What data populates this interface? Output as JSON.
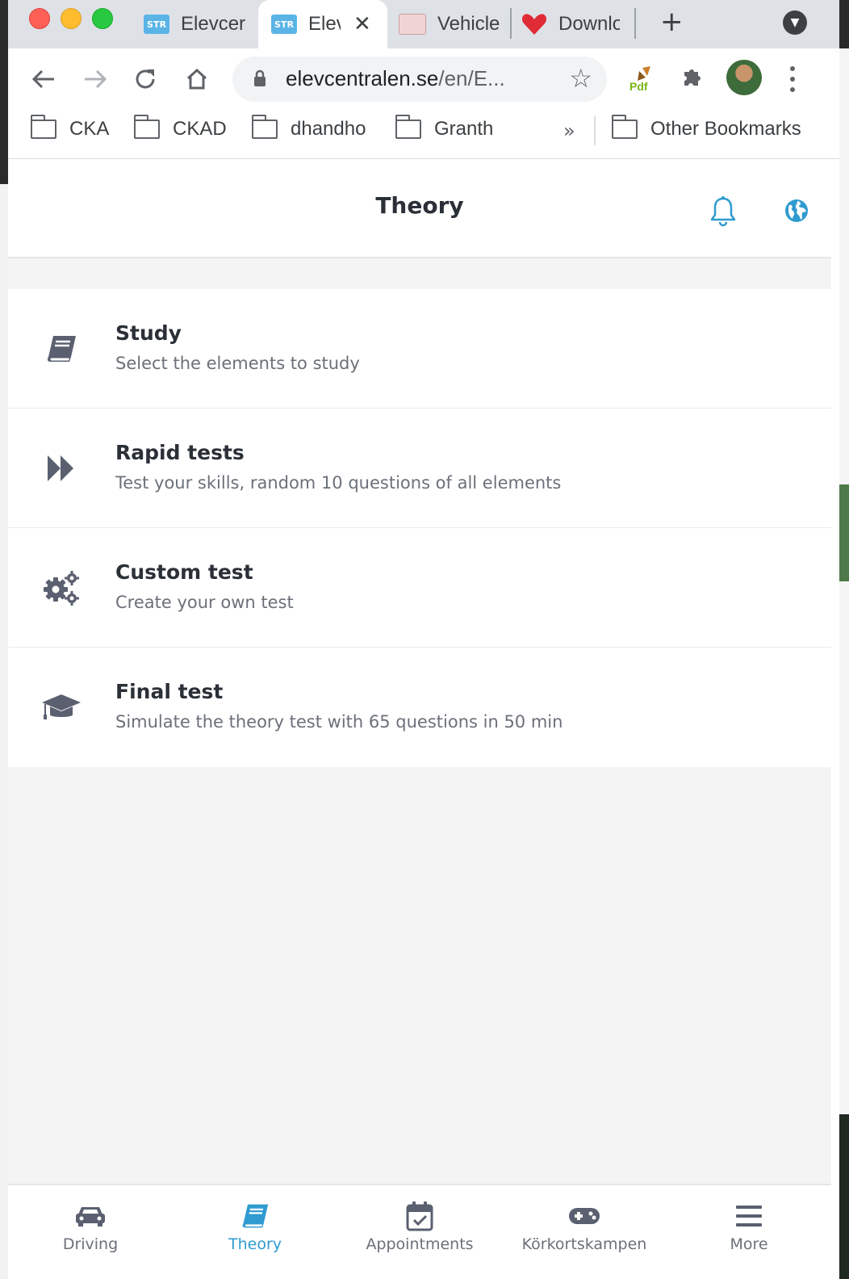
{
  "browser": {
    "tabs": [
      {
        "title": "Elevcer",
        "favicon": "str-favicon",
        "active": false
      },
      {
        "title": "Elev",
        "favicon": "str-favicon",
        "active": true
      },
      {
        "title": "Vehicle",
        "favicon": "license-favicon",
        "active": false
      },
      {
        "title": "Downlo",
        "favicon": "heart-favicon",
        "active": false
      }
    ],
    "new_tab_label": "+",
    "address": {
      "domain": "elevcentralen.se",
      "path": "/en/E..."
    },
    "bookmarks": [
      "CKA",
      "CKAD",
      "dhandho",
      "Granth"
    ],
    "bookmarks_overflow": "»",
    "other_bookmarks": "Other Bookmarks"
  },
  "app": {
    "title": "Theory",
    "accent_color": "#2f9bd0",
    "menu": [
      {
        "title": "Study",
        "subtitle": "Select the elements to study",
        "icon": "book-icon"
      },
      {
        "title": "Rapid tests",
        "subtitle": "Test your skills, random 10 questions of all elements",
        "icon": "fast-forward-icon"
      },
      {
        "title": "Custom test",
        "subtitle": "Create your own test",
        "icon": "gears-icon"
      },
      {
        "title": "Final test",
        "subtitle": "Simulate the theory test with 65 questions in 50 min",
        "icon": "graduation-cap-icon"
      }
    ],
    "bottom_nav": [
      {
        "label": "Driving",
        "icon": "car-icon",
        "active": false
      },
      {
        "label": "Theory",
        "icon": "book-icon",
        "active": true
      },
      {
        "label": "Appointments",
        "icon": "calendar-check-icon",
        "active": false
      },
      {
        "label": "Körkortskampen",
        "icon": "gamepad-icon",
        "active": false
      },
      {
        "label": "More",
        "icon": "menu-icon",
        "active": false
      }
    ]
  }
}
